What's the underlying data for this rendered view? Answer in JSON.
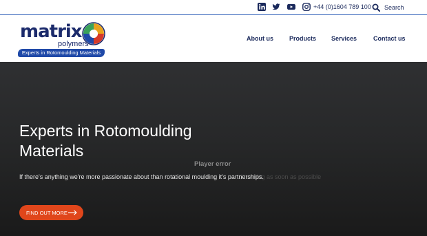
{
  "topbar": {
    "social": [
      "linkedin-icon",
      "twitter-icon",
      "youtube-icon",
      "instagram-icon"
    ],
    "phone": "+44 (0)1604 789 100",
    "search_label": "Search"
  },
  "logo": {
    "word": "matrix",
    "sub": "polymers",
    "tagline": "Experts in Rotomoulding Materials"
  },
  "nav": {
    "items": [
      "About us",
      "Products",
      "Services",
      "Contact us"
    ]
  },
  "hero": {
    "title": "Experts in Rotomoulding Materials",
    "text": "If there's anything we're more passionate about than rotational moulding it's partnerships.",
    "player_error": "Player error",
    "ghost_text": "d running as soon as possible",
    "cta_label": "FIND OUT MORE"
  },
  "colors": {
    "brand_navy": "#1b2a6b",
    "brand_blue": "#1f49a8",
    "accent_orange": "#e0461b",
    "hero_bg": "#262728"
  }
}
